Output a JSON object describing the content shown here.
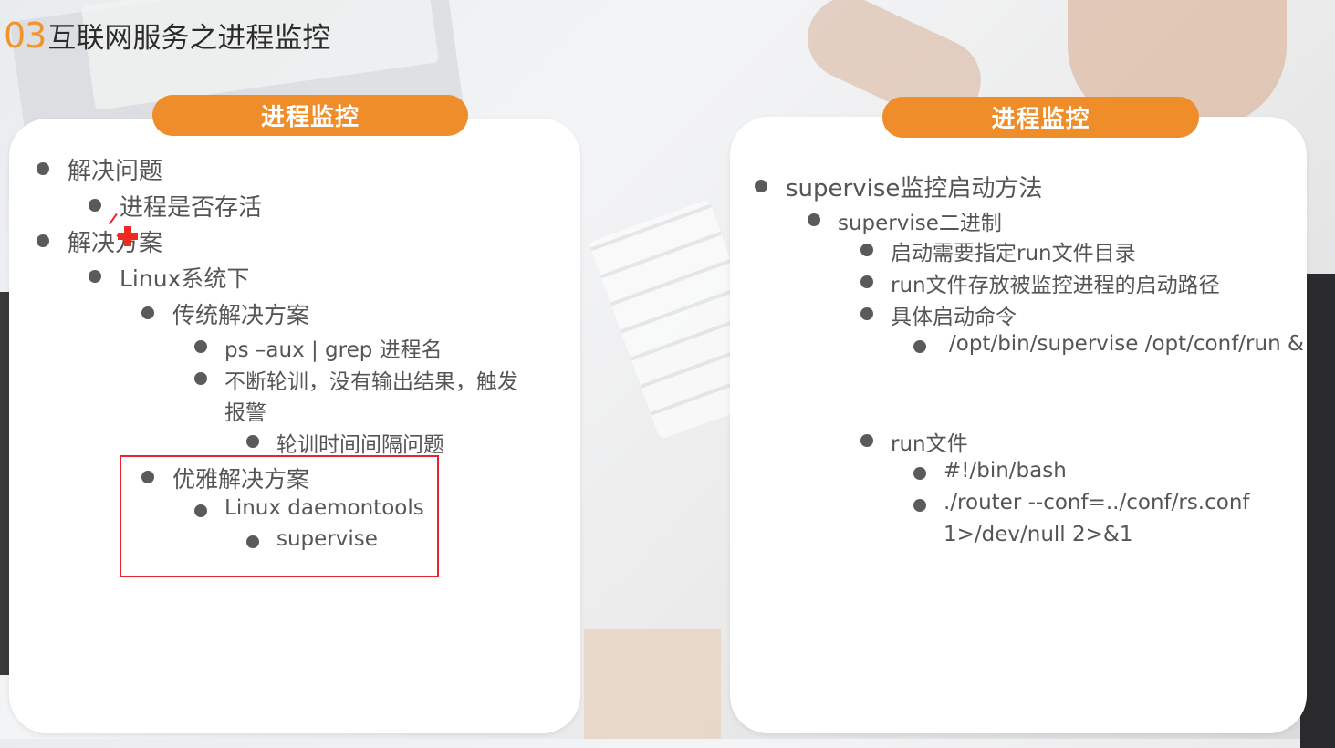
{
  "header": {
    "number": "03",
    "title": "互联网服务之进程监控"
  },
  "left_panel": {
    "heading": "进程监控",
    "items": [
      {
        "text": "解决问题"
      },
      {
        "text": "进程是否存活"
      },
      {
        "text": "解决方案"
      },
      {
        "text": "Linux系统下"
      },
      {
        "text": "传统解决方案"
      },
      {
        "text": "ps –aux | grep 进程名"
      },
      {
        "text": "不断轮训，没有输出结果，触发"
      },
      {
        "text": "报警"
      },
      {
        "text": "轮训时间间隔问题"
      },
      {
        "text": "优雅解决方案"
      },
      {
        "text": "Linux daemontools"
      },
      {
        "text": "supervise"
      }
    ]
  },
  "right_panel": {
    "heading": "进程监控",
    "items": [
      {
        "text": "supervise监控启动方法"
      },
      {
        "text": "supervise二进制"
      },
      {
        "text": "启动需要指定run文件目录"
      },
      {
        "text": "run文件存放被监控进程的启动路径"
      },
      {
        "text": "具体启动命令"
      },
      {
        "text": "/opt/bin/supervise /opt/conf/run &"
      },
      {
        "text": "run文件"
      },
      {
        "text": "#!/bin/bash"
      },
      {
        "text": "./router --conf=../conf/rs.conf"
      },
      {
        "text": "1>/dev/null  2>&1"
      }
    ]
  },
  "colors": {
    "accent": "#ef8d2a",
    "highlight_box": "#e5262d",
    "text": "#555555"
  }
}
